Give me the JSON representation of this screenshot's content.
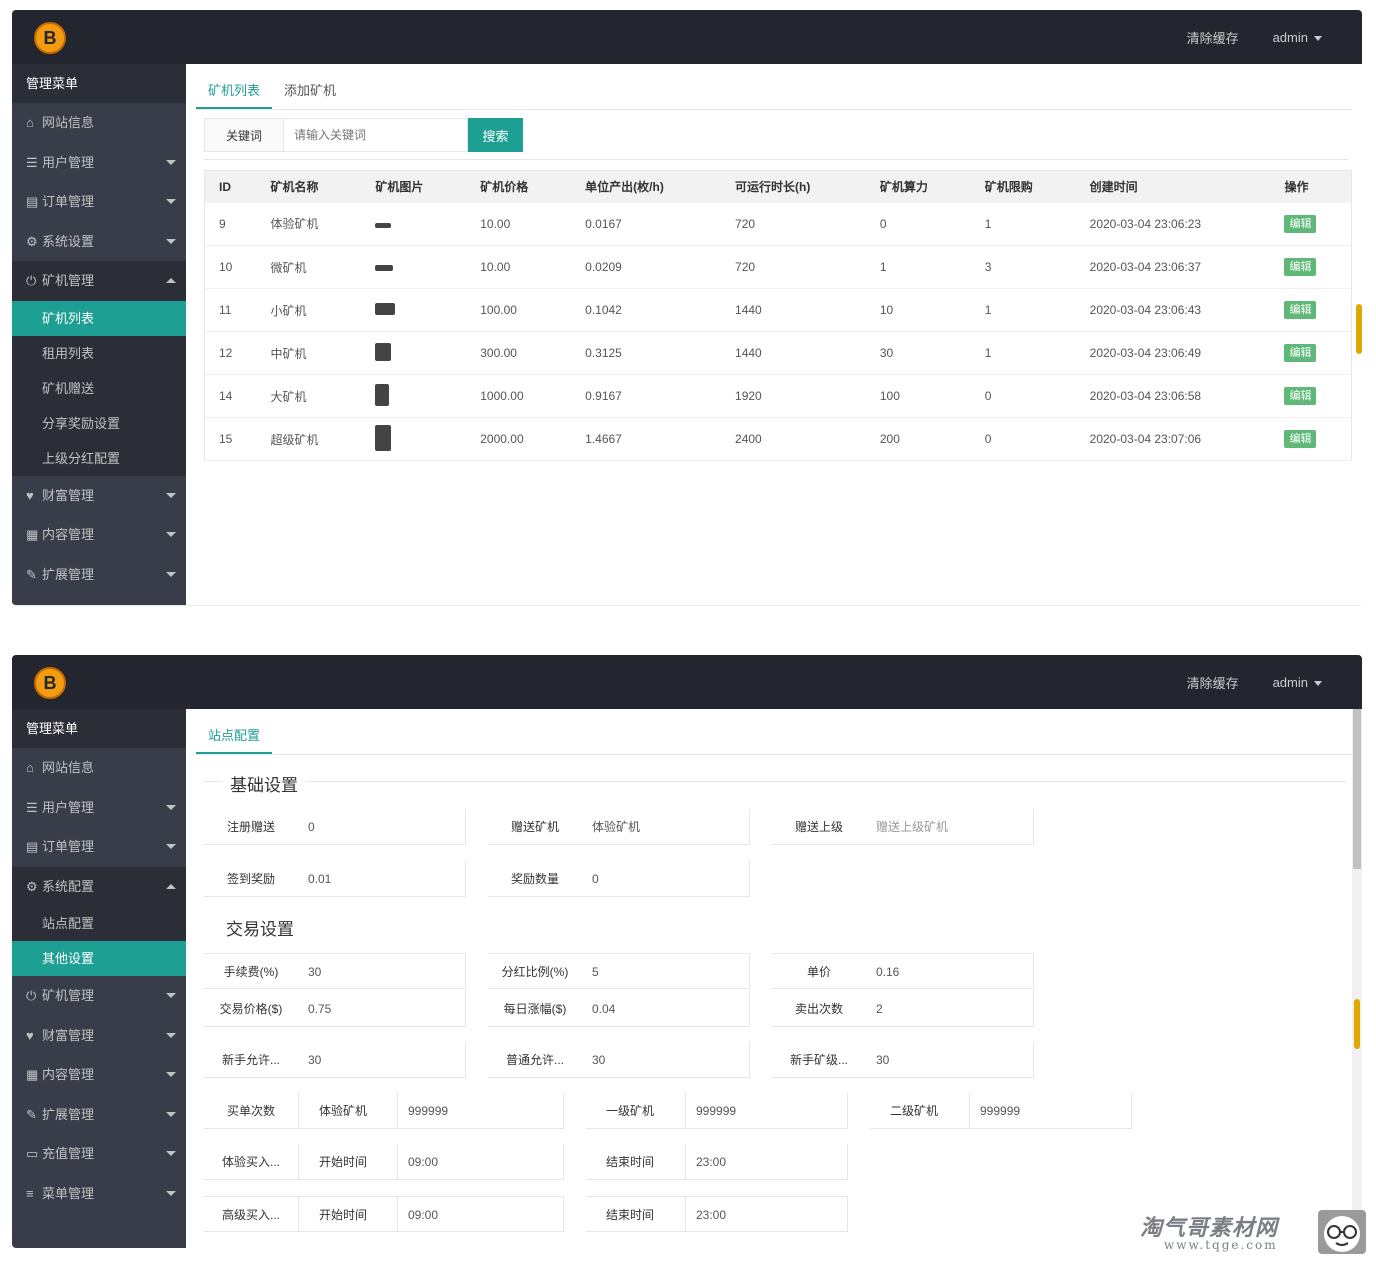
{
  "frame1": {
    "logo": "B",
    "header": {
      "clear_cache": "清除缓存",
      "user": "admin"
    },
    "sidebar": {
      "title": "管理菜单",
      "items": [
        {
          "icon": "home-icon",
          "glyph": "⌂",
          "label": "网站信息"
        },
        {
          "icon": "users-icon",
          "glyph": "☰",
          "label": "用户管理"
        },
        {
          "icon": "order-icon",
          "glyph": "▤",
          "label": "订单管理"
        },
        {
          "icon": "gear-icon",
          "glyph": "⚙",
          "label": "系统设置"
        },
        {
          "icon": "power-icon",
          "glyph": "⏻",
          "label": "矿机管理"
        },
        {
          "icon": "heart-icon",
          "glyph": "♥",
          "label": "财富管理"
        },
        {
          "icon": "doc-icon",
          "glyph": "▦",
          "label": "内容管理"
        },
        {
          "icon": "wrench-icon",
          "glyph": "✎",
          "label": "扩展管理"
        }
      ],
      "subitems": [
        "矿机列表",
        "租用列表",
        "矿机赠送",
        "分享奖励设置",
        "上级分红配置"
      ]
    },
    "tabs": [
      "矿机列表",
      "添加矿机"
    ],
    "search": {
      "label": "关键词",
      "placeholder": "请输入关键词",
      "button": "搜索"
    },
    "table": {
      "headers": [
        "ID",
        "矿机名称",
        "矿机图片",
        "矿机价格",
        "单位产出(枚/h)",
        "可运行时长(h)",
        "矿机算力",
        "矿机限购",
        "创建时间",
        "操作"
      ],
      "rows": [
        [
          "9",
          "体验矿机",
          "",
          "10.00",
          "0.0167",
          "720",
          "0",
          "1",
          "2020-03-04 23:06:23",
          "编辑"
        ],
        [
          "10",
          "微矿机",
          "",
          "10.00",
          "0.0209",
          "720",
          "1",
          "3",
          "2020-03-04 23:06:37",
          "编辑"
        ],
        [
          "11",
          "小矿机",
          "",
          "100.00",
          "0.1042",
          "1440",
          "10",
          "1",
          "2020-03-04 23:06:43",
          "编辑"
        ],
        [
          "12",
          "中矿机",
          "",
          "300.00",
          "0.3125",
          "1440",
          "30",
          "1",
          "2020-03-04 23:06:49",
          "编辑"
        ],
        [
          "14",
          "大矿机",
          "",
          "1000.00",
          "0.9167",
          "1920",
          "100",
          "0",
          "2020-03-04 23:06:58",
          "编辑"
        ],
        [
          "15",
          "超级矿机",
          "",
          "2000.00",
          "1.4667",
          "2400",
          "200",
          "0",
          "2020-03-04 23:07:06",
          "编辑"
        ]
      ]
    }
  },
  "frame2": {
    "logo": "B",
    "header": {
      "clear_cache": "清除缓存",
      "user": "admin"
    },
    "sidebar": {
      "title": "管理菜单",
      "items": [
        {
          "icon": "home-icon",
          "glyph": "⌂",
          "label": "网站信息"
        },
        {
          "icon": "users-icon",
          "glyph": "☰",
          "label": "用户管理"
        },
        {
          "icon": "order-icon",
          "glyph": "▤",
          "label": "订单管理"
        },
        {
          "icon": "gear-icon",
          "glyph": "⚙",
          "label": "系统配置"
        },
        {
          "icon": "power-icon",
          "glyph": "⏻",
          "label": "矿机管理"
        },
        {
          "icon": "heart-icon",
          "glyph": "♥",
          "label": "财富管理"
        },
        {
          "icon": "doc-icon",
          "glyph": "▦",
          "label": "内容管理"
        },
        {
          "icon": "wrench-icon",
          "glyph": "✎",
          "label": "扩展管理"
        },
        {
          "icon": "card-icon",
          "glyph": "▭",
          "label": "充值管理"
        },
        {
          "icon": "menu-icon",
          "glyph": "≡",
          "label": "菜单管理"
        }
      ],
      "subitems": [
        "站点配置",
        "其他设置"
      ]
    },
    "tabs": [
      "站点配置"
    ],
    "sections": {
      "basic": "基础设置",
      "trade": "交易设置"
    },
    "fields": {
      "reg_gift": {
        "label": "注册赠送",
        "value": "0"
      },
      "gift_miner": {
        "label": "赠送矿机",
        "value": "体验矿机"
      },
      "gift_upper": {
        "label": "赠送上级",
        "placeholder": "赠送上级矿机"
      },
      "sign_reward": {
        "label": "签到奖励",
        "value": "0.01"
      },
      "other": {
        "label": "奖励数量",
        "value": "0"
      },
      "fee": {
        "label": "手续费(%)",
        "value": "30"
      },
      "rate": {
        "label": "分红比例(%)",
        "value": "5"
      },
      "price": {
        "label": "单价",
        "value": "0.16"
      },
      "trade_price": {
        "label": "交易价格($)",
        "value": "0.75"
      },
      "daily_rise": {
        "label": "每日涨幅($)",
        "value": "0.04"
      },
      "sell_times": {
        "label": "卖出次数",
        "value": "2"
      },
      "f1": {
        "label": "新手允许...",
        "value": "30"
      },
      "f2": {
        "label": "普通允许...",
        "value": "30"
      },
      "f3": {
        "label": "新手矿级...",
        "value": "30"
      },
      "buy_limit": {
        "label": "买单次数",
        "sub1": "体验矿机",
        "v1": "999999",
        "sub2": "一级矿机",
        "v2": "999999",
        "sub3": "二级矿机",
        "v3": "999999"
      },
      "beginner_buy": {
        "label": "体验买入...",
        "start": "开始时间",
        "start_v": "09:00",
        "end": "结束时间",
        "end_v": "23:00"
      },
      "senior_buy": {
        "label": "高级买入...",
        "start": "开始时间",
        "start_v": "09:00",
        "end": "结束时间",
        "end_v": "23:00"
      }
    }
  },
  "watermark": {
    "cn": "淘气哥素材网",
    "url": "www.tqge.com"
  },
  "colors": {
    "accent": "#1e9f93",
    "edit": "#5fb878",
    "topbar": "#23262e",
    "sidebar": "#393d49"
  }
}
